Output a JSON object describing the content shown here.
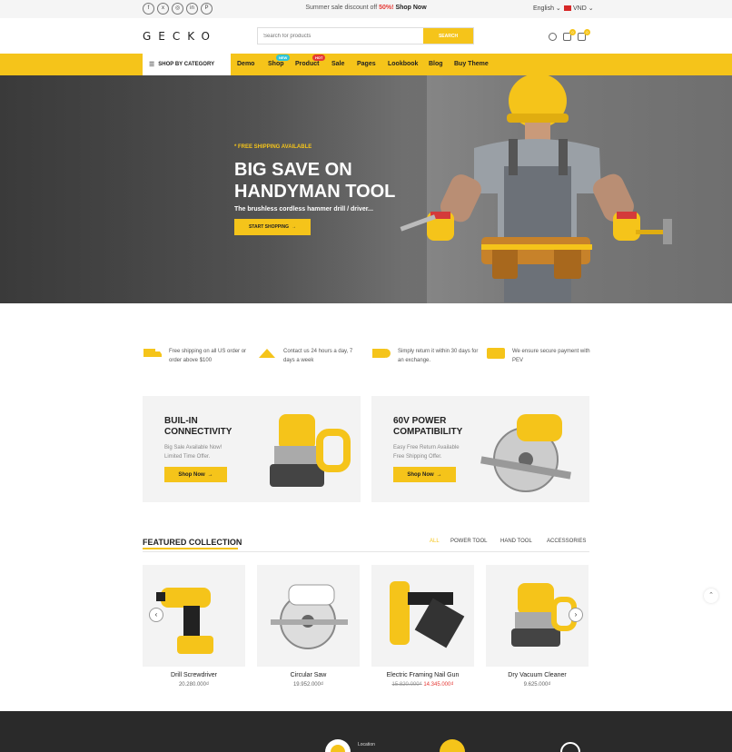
{
  "topbar": {
    "socials": [
      "f",
      "x",
      "◎",
      "in",
      "P"
    ],
    "promo_prefix": "Summer sale discount off ",
    "promo_pct": "50%!",
    "promo_link": "Shop Now",
    "language": "English ⌄",
    "currency": "VND ⌄"
  },
  "header": {
    "logo": "GECKO",
    "search_placeholder": "Search for products",
    "search_button": "SEARCH",
    "wishlist_count": "0",
    "cart_count": "0"
  },
  "nav": {
    "category_label": "SHOP BY CATEGORY",
    "items": [
      "Demo",
      "Shop",
      "Product",
      "Sale",
      "Pages",
      "Lookbook",
      "Blog",
      "Buy Theme"
    ],
    "shop_badge": "NEW",
    "product_badge": "HOT",
    "colors": {
      "accent": "#f5c41a",
      "new": "#2ec4d6",
      "hot": "#e53935"
    }
  },
  "hero": {
    "label": "* FREE SHIPPING AVAILABLE",
    "title_line1": "BIG SAVE ON",
    "title_line2": "HANDYMAN TOOL",
    "subtitle": "The brushless cordless hammer drill / driver...",
    "button": "START SHOPPING"
  },
  "features": [
    {
      "icon": "truck-icon",
      "text": "Free shipping on all US order or order above $100"
    },
    {
      "icon": "support-icon",
      "text": "Contact us 24 hours a day, 7 days a week"
    },
    {
      "icon": "return-icon",
      "text": "Simply return it within 30 days for an exchange."
    },
    {
      "icon": "card-icon",
      "text": "We ensure secure payment with PEV"
    }
  ],
  "banners": [
    {
      "title_line1": "BUIL-IN",
      "title_line2": "CONNECTIVITY",
      "sub_line1": "Big Sale Available Now!",
      "sub_line2": "Limited Time Offer.",
      "button": "Shop Now"
    },
    {
      "title_line1": "60V POWER",
      "title_line2": "COMPATIBILITY",
      "sub_line1": "Easy Free Return Available",
      "sub_line2": "Free Shipping Offer.",
      "button": "Shop Now"
    }
  ],
  "collection": {
    "title": "FEATURED COLLECTION",
    "tabs": [
      "ALL",
      "POWER TOOL",
      "HAND TOOL",
      "ACCESSORIES"
    ],
    "products": [
      {
        "name": "Drill Screwdriver",
        "price": "20.280.000₫"
      },
      {
        "name": "Circular Saw",
        "price": "19.952.000₫"
      },
      {
        "name": "Electric Framing Nail Gun",
        "old_price": "15.820.000₫",
        "price": "14.345.000₫"
      },
      {
        "name": "Dry Vacuum Cleaner",
        "price": "9.625.000₫"
      }
    ]
  },
  "footer": {
    "item": "Location"
  }
}
